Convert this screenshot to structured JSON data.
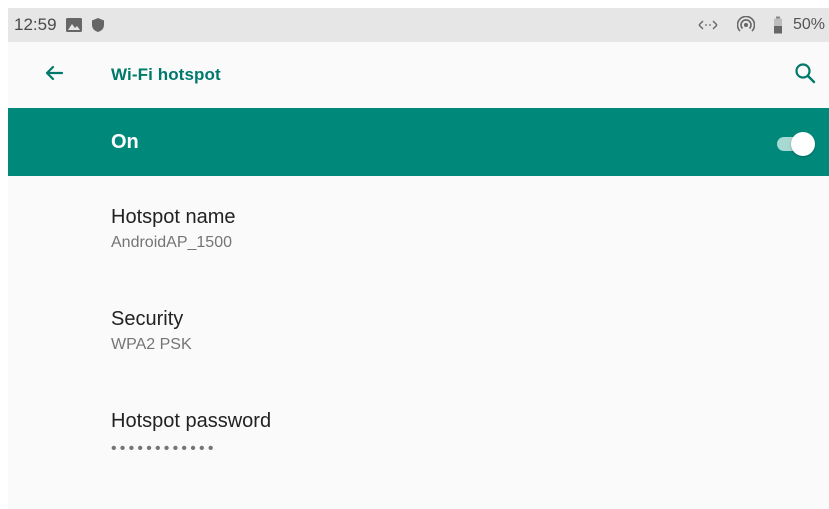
{
  "status_bar": {
    "time": "12:59",
    "battery": "50%",
    "icons": [
      "image-icon",
      "shield-icon",
      "data-activity-icon",
      "hotspot-icon",
      "battery-icon"
    ]
  },
  "app_bar": {
    "title": "Wi-Fi hotspot",
    "icons": [
      "back-arrow-icon",
      "search-icon"
    ]
  },
  "master_switch": {
    "label": "On",
    "checked": true
  },
  "preferences": [
    {
      "title": "Hotspot name",
      "summary": "AndroidAP_1500"
    },
    {
      "title": "Security",
      "summary": "WPA2 PSK"
    },
    {
      "title": "Hotspot password",
      "summary": "••••••••••••"
    }
  ],
  "colors": {
    "accent": "#00796b",
    "switch_bar": "#00897b",
    "status_bar_bg": "#e6e6e6",
    "background": "#fafafa"
  }
}
